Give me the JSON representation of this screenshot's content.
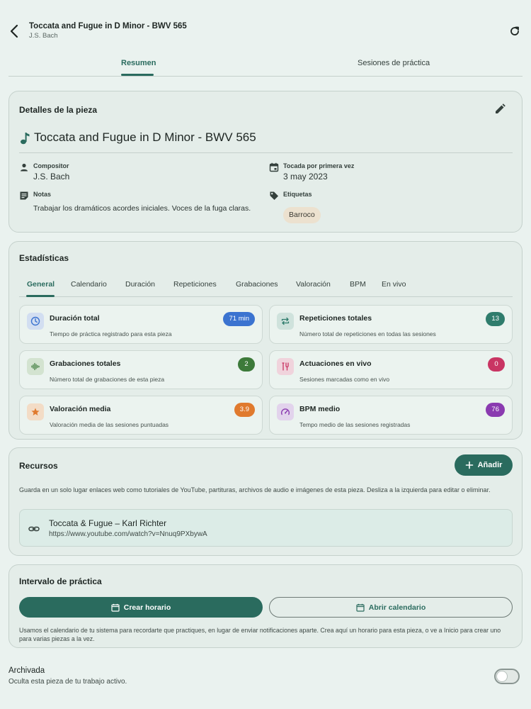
{
  "header": {
    "title": "Toccata and Fugue in D Minor - BWV 565",
    "subtitle": "J.S. Bach"
  },
  "tabs": [
    "Resumen",
    "Sesiones de práctica"
  ],
  "details": {
    "heading": "Detalles de la pieza",
    "piece_title": "Toccata and Fugue in D Minor - BWV 565",
    "composer_label": "Compositor",
    "composer_value": "J.S. Bach",
    "first_played_label": "Tocada por primera vez",
    "first_played_value": "3 may 2023",
    "notes_label": "Notas",
    "notes_value": "Trabajar los dramáticos acordes iniciales. Voces de la fuga claras.",
    "tags_label": "Etiquetas",
    "tags": [
      "Barroco"
    ]
  },
  "stats": {
    "heading": "Estadísticas",
    "tabs": [
      "General",
      "Calendario",
      "Duración",
      "Repeticiones",
      "Grabaciones",
      "Valoración",
      "BPM",
      "En vivo"
    ],
    "cards": [
      {
        "title": "Duración total",
        "desc": "Tiempo de práctica registrado para esta pieza",
        "badge": "71 min",
        "color": "#3b73d0",
        "icon": "clock-icon"
      },
      {
        "title": "Repeticiones totales",
        "desc": "Número total de repeticiones en todas las sesiones",
        "badge": "13",
        "color": "#2f7c6c",
        "icon": "repeat-icon"
      },
      {
        "title": "Grabaciones totales",
        "desc": "Número total de grabaciones de esta pieza",
        "badge": "2",
        "color": "#3d7a3a",
        "icon": "audio-wave-icon"
      },
      {
        "title": "Actuaciones en vivo",
        "desc": "Sesiones marcadas como en vivo",
        "badge": "0",
        "color": "#c93563",
        "icon": "live-icon"
      },
      {
        "title": "Valoración media",
        "desc": "Valoración media de las sesiones puntuadas",
        "badge": "3.9",
        "color": "#e07a2e",
        "icon": "star-icon"
      },
      {
        "title": "BPM medio",
        "desc": "Tempo medio de las sesiones registradas",
        "badge": "76",
        "color": "#8a3ab0",
        "icon": "speedometer-icon"
      }
    ]
  },
  "resources": {
    "heading": "Recursos",
    "add_label": "Añadir",
    "description": "Guarda en un solo lugar enlaces web como tutoriales de YouTube, partituras, archivos de audio e imágenes de esta pieza. Desliza a la izquierda para editar o eliminar.",
    "items": [
      {
        "title": "Toccata & Fugue – Karl Richter",
        "url": "https://www.youtube.com/watch?v=Nnuq9PXbywA"
      }
    ]
  },
  "interval": {
    "heading": "Intervalo de práctica",
    "create_label": "Crear horario",
    "open_label": "Abrir calendario",
    "description": "Usamos el calendario de tu sistema para recordarte que practiques, en lugar de enviar notificaciones aparte. Crea aquí un horario para esta pieza, o ve a Inicio para crear uno para varias piezas a la vez."
  },
  "archived": {
    "title": "Archivada",
    "description": "Oculta esta pieza de tu trabajo activo.",
    "enabled": false
  }
}
